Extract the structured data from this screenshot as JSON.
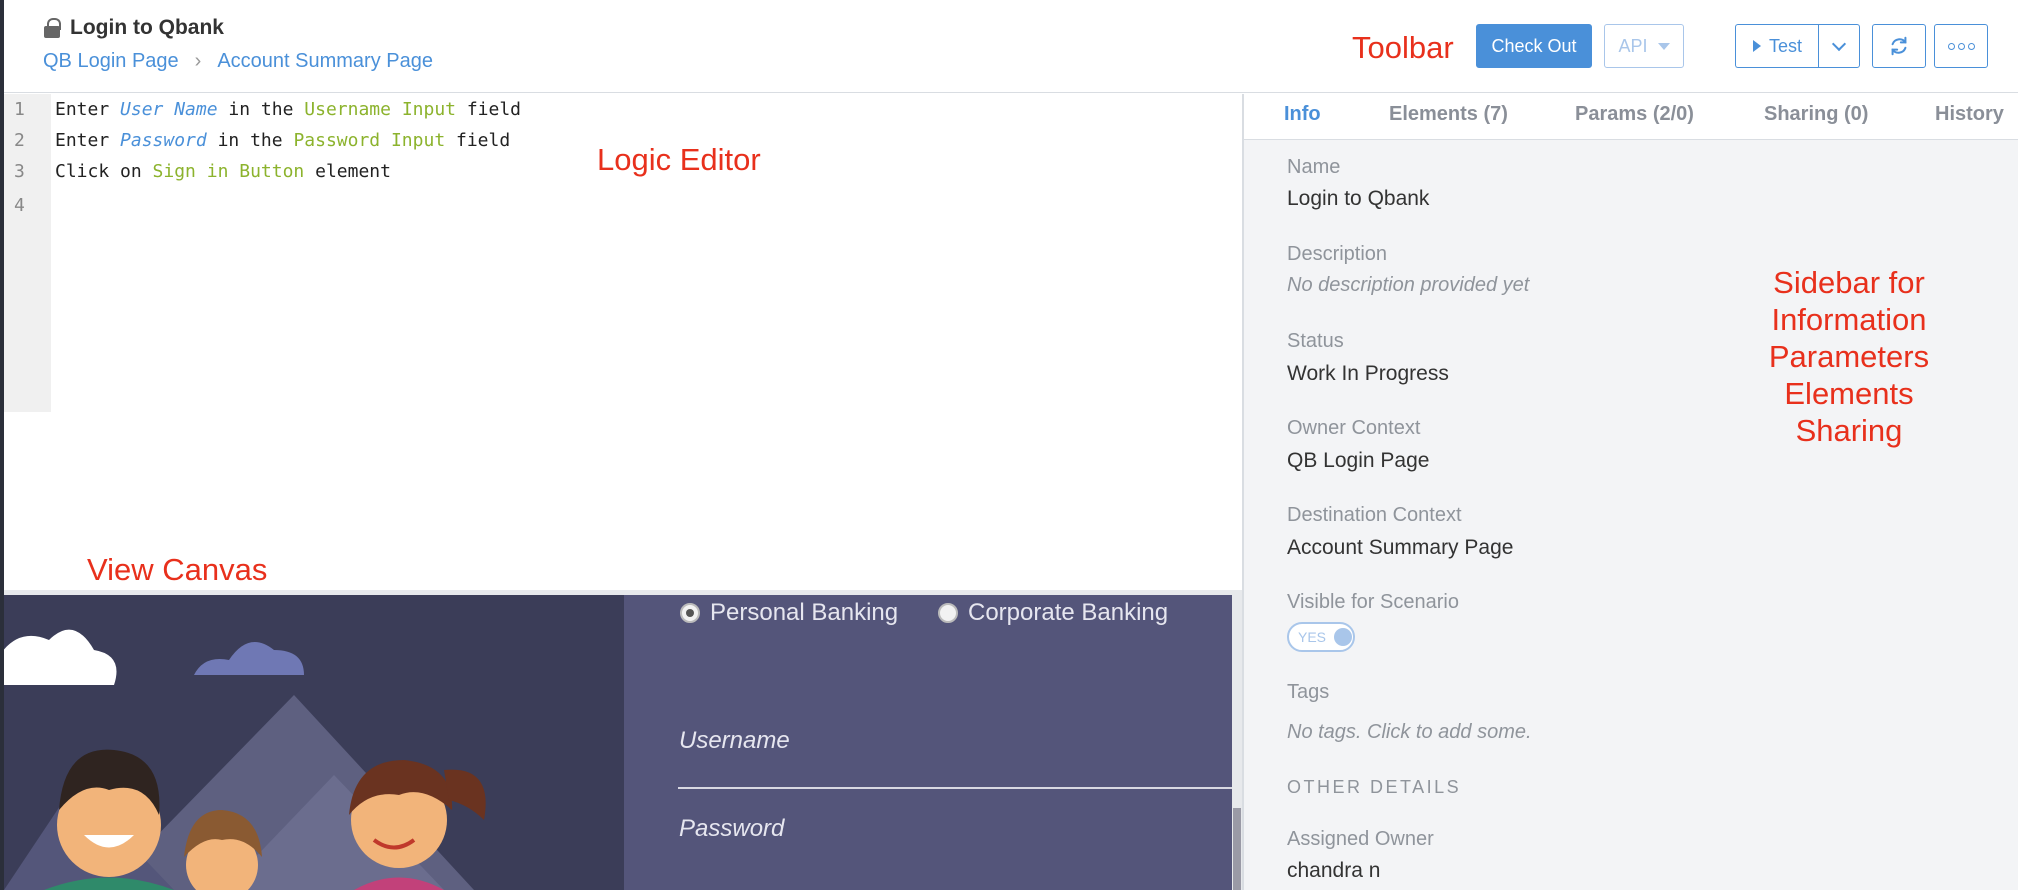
{
  "header": {
    "title": "Login to Qbank",
    "breadcrumb": [
      "QB Login Page",
      "Account Summary Page"
    ]
  },
  "toolbar": {
    "checkout_label": "Check Out",
    "api_label": "API",
    "test_label": "Test"
  },
  "annotations": {
    "toolbar": "Toolbar",
    "logic_editor": "Logic Editor",
    "view_canvas": "View Canvas",
    "sidebar": [
      "Sidebar for",
      "Information",
      "Parameters",
      "Elements",
      "Sharing"
    ]
  },
  "editor": {
    "lines": [
      {
        "number": "1",
        "parts": [
          [
            "plain",
            "Enter "
          ],
          [
            "param",
            "User Name"
          ],
          [
            "plain",
            " in the "
          ],
          [
            "element",
            "Username Input"
          ],
          [
            "plain",
            " field"
          ]
        ]
      },
      {
        "number": "2",
        "parts": [
          [
            "plain",
            "Enter "
          ],
          [
            "param",
            "Password"
          ],
          [
            "plain",
            " in the "
          ],
          [
            "element",
            "Password Input"
          ],
          [
            "plain",
            " field"
          ]
        ]
      },
      {
        "number": "3",
        "parts": [
          [
            "plain",
            "Click on "
          ],
          [
            "element",
            "Sign in Button"
          ],
          [
            "plain",
            " element"
          ]
        ]
      },
      {
        "number": "4",
        "parts": []
      }
    ]
  },
  "canvas": {
    "radio_personal": "Personal Banking",
    "radio_corporate": "Corporate Banking",
    "username_placeholder": "Username",
    "password_placeholder": "Password"
  },
  "sidebar": {
    "tabs": [
      "Info",
      "Elements (7)",
      "Params (2/0)",
      "Sharing (0)",
      "History"
    ],
    "active_tab": "Info",
    "fields": {
      "name_label": "Name",
      "name_value": "Login to Qbank",
      "description_label": "Description",
      "description_value": "No description provided yet",
      "status_label": "Status",
      "status_value": "Work In Progress",
      "owner_context_label": "Owner Context",
      "owner_context_value": "QB Login Page",
      "destination_context_label": "Destination Context",
      "destination_context_value": "Account Summary Page",
      "visible_label": "Visible for Scenario",
      "visible_value": "YES",
      "tags_label": "Tags",
      "tags_value": "No tags. Click to add some.",
      "other_details": "OTHER DETAILS",
      "assigned_owner_label": "Assigned Owner",
      "assigned_owner_value": "chandra n"
    }
  },
  "colors": {
    "accent": "#4a90d9",
    "annotation": "#e8301c",
    "element_keyword": "#8cb32d",
    "param_keyword": "#4a90d9"
  }
}
